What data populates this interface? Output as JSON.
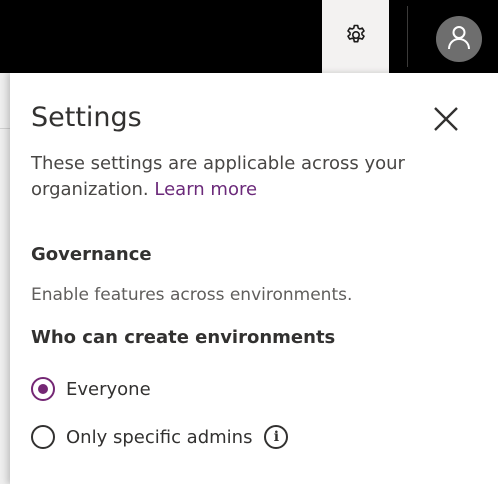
{
  "header": {
    "settings_icon": "gear-icon",
    "profile_icon": "person-icon"
  },
  "panel": {
    "title": "Settings",
    "close_icon": "close-icon",
    "description": "These settings are applicable across your organization.",
    "learn_more": "Learn more",
    "section_title": "Governance",
    "section_description": "Enable features across environments.",
    "question": "Who can create environments",
    "options": [
      {
        "label": "Everyone",
        "selected": true
      },
      {
        "label": "Only specific admins",
        "selected": false
      }
    ],
    "info_icon": "info-icon",
    "info_glyph": "i"
  },
  "colors": {
    "topbar": "#000000",
    "accent": "#742774",
    "link": "#6b2a7a"
  }
}
